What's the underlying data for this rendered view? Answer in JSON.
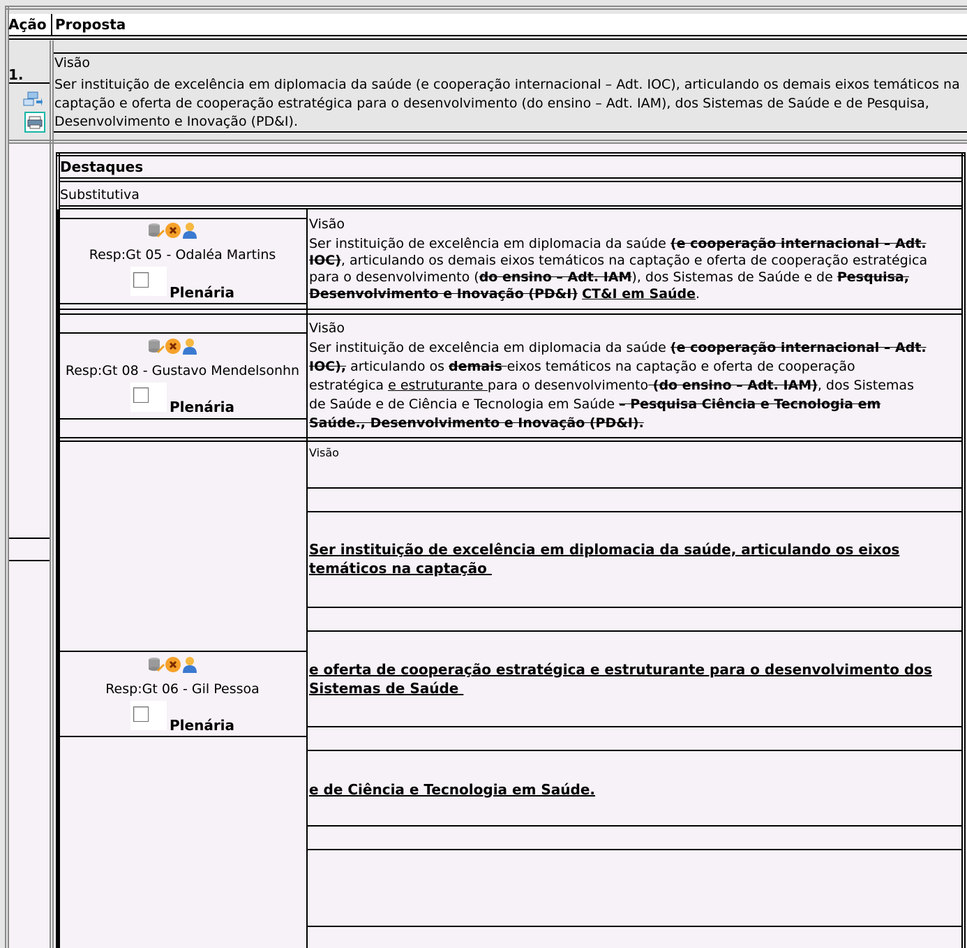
{
  "header": {
    "col_acao": "Ação",
    "col_proposta": "Proposta"
  },
  "item": {
    "number": "1.",
    "vision_label": "Visão",
    "vision_text": "Ser instituição de excelência em diplomacia da saúde (e cooperação internacional – Adt. IOC), articulando os demais eixos temáticos na captação e oferta de cooperação estratégica para o desenvolvimento (do ensino – Adt. IAM), dos Sistemas de Saúde e de Pesquisa, Desenvolvimento e Inovação (PD&I)."
  },
  "highlights": {
    "title": "Destaques",
    "type": "Substitutiva",
    "checkbox_label": "Plenária",
    "entries": [
      {
        "resp": "Resp:Gt 05 - Odaléa Martins",
        "vision_label": "Visão",
        "t1": "Ser instituição de excelência em diplomacia da saúde ",
        "d1": "(e cooperação internacional – Adt.",
        "d2": "IOC)",
        "t2": ", articulando os demais eixos temáticos na captação e oferta de cooperação estratégica",
        "t3": "para o desenvolvimento (",
        "d3": "do ensino – Adt. IAM",
        "t4": "), dos Sistemas de Saúde e de ",
        "d4": "Pesquisa,",
        "d5": "Desenvolvimento e Inovação (PD&I)",
        "i1": "CT&I em Saúde",
        "t5": "."
      },
      {
        "resp": "Resp:Gt 08 - Gustavo Mendelsonhn",
        "vision_label": "Visão",
        "t1": "Ser instituição de excelência em diplomacia da saúde ",
        "d1": "(e cooperação internacional – Adt.",
        "d2": "IOC),",
        "t2": " articulando os ",
        "d3": "demais ",
        "t3": "eixos temáticos na captação e oferta de cooperação",
        "t4": "estratégica ",
        "i1": "e estruturante ",
        "t5": "para o desenvolvimento",
        "d4": " (do ensino – Adt. IAM)",
        "t6": ", dos Sistemas",
        "t7": "de Saúde e de Ciência e Tecnologia em Saúde ",
        "d5": " – Pesquisa Ciência e Tecnologia em",
        "d6": "Saúde., Desenvolvimento e Inovação (PD&I)."
      },
      {
        "resp": "Resp:Gt 06 - Gil Pessoa",
        "vision_label": "Visão",
        "p1a": "Ser instituição de excelência em diplomacia da saúde, articulando os eixos",
        "p1b": "temáticos na captação ",
        "p2a": "e oferta de cooperação estratégica e estruturante para o desenvolvimento dos",
        "p2b": "Sistemas de Saúde ",
        "p3": "e de Ciência e Tecnologia em Saúde."
      }
    ]
  },
  "icons": {
    "transfer": "transfer-icon",
    "print": "printer-icon",
    "database_edit": "database-edit-icon",
    "delete": "delete-icon",
    "user": "user-icon"
  },
  "colors": {
    "gray_band": "#e6e6e6",
    "pink_bg": "#f7f2f7",
    "border_gray": "#8a8a8a"
  }
}
